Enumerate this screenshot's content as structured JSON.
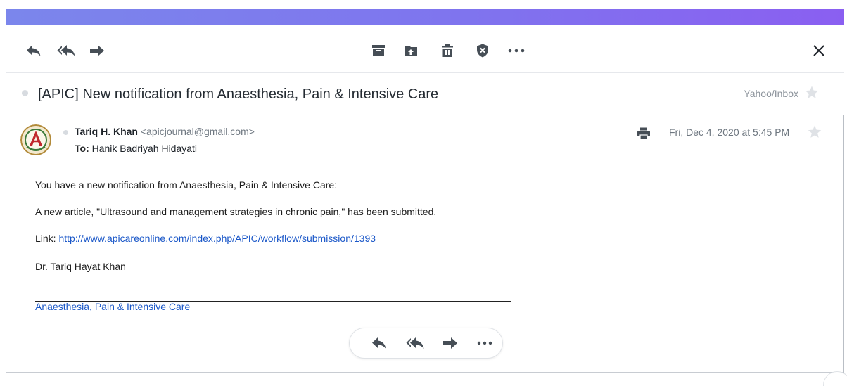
{
  "header": {
    "accent_color": "#7f7bef"
  },
  "toolbar": {
    "left_icons": [
      "reply-icon",
      "reply-all-icon",
      "forward-icon"
    ],
    "center_icons": [
      "archive-icon",
      "move-icon",
      "delete-icon",
      "spam-icon",
      "more-icon"
    ],
    "close_icon": "close-icon",
    "close_label": "×"
  },
  "subject": {
    "text": "[APIC] New notification from Anaesthesia, Pain & Intensive Care",
    "folder": "Yahoo/Inbox"
  },
  "message": {
    "sender_name": "Tariq H. Khan",
    "sender_email": "<apicjournal@gmail.com>",
    "to_label": "To:",
    "to_name": "Hanik Badriyah Hidayati",
    "date": "Fri, Dec 4, 2020 at 5:45 PM",
    "body": {
      "line1": "You have a new notification from Anaesthesia, Pain & Intensive Care:",
      "line2": "A new article, \"Ultrasound and management strategies in chronic pain,\" has been submitted.",
      "link_label": "Link: ",
      "link_url": "http://www.apicareonline.com/index.php/APIC/workflow/submission/1393",
      "signature": "Dr. Tariq Hayat Khan",
      "footer_link": "Anaesthesia, Pain & Intensive Care"
    }
  },
  "colors": {
    "link": "#1a57c8",
    "icon": "#464e56",
    "star": "#dfe2e6"
  }
}
